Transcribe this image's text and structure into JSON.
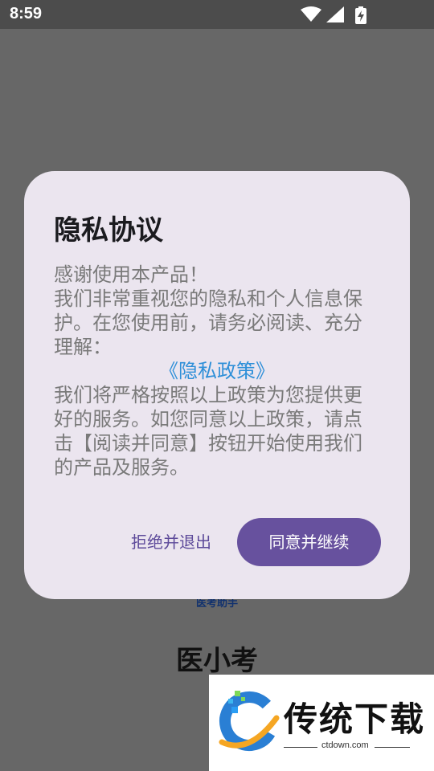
{
  "status_bar": {
    "time": "8:59"
  },
  "background": {
    "app_subtitle": "医考助手",
    "app_name": "医小考"
  },
  "dialog": {
    "title": "隐私协议",
    "intro_lines": [
      "感谢使用本产品！",
      "我们非常重视您的隐私和个人信息保护。在您使用前，请务必阅读、充分理解："
    ],
    "policy_link": "《隐私政策》",
    "closing": "我们将严格按照以上政策为您提供更好的服务。如您同意以上政策，请点击【阅读并同意】按钮开始使用我们的产品及服务。",
    "reject_label": "拒绝并退出",
    "accept_label": "同意并继续"
  },
  "watermark": {
    "name": "传统下载",
    "url": "ctdown.com"
  },
  "colors": {
    "accent": "#67519e",
    "link": "#2e8fd8",
    "dialog_bg": "#ebe5ef",
    "scrim": "#676767"
  }
}
